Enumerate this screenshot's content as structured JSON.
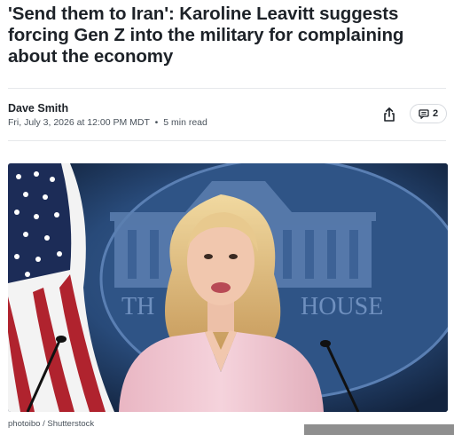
{
  "article": {
    "headline": "'Send them to Iran': Karoline Leavitt suggests forcing Gen Z into the military for complaining about the economy",
    "author": "Dave Smith",
    "date": "Fri, July 3, 2026 at 12:00 PM MDT",
    "separator": "•",
    "read_time": "5 min read"
  },
  "actions": {
    "share_icon": "share-icon",
    "comment_icon": "comment-icon",
    "comment_count": "2"
  },
  "photo": {
    "backdrop_text": "HOUSE",
    "backdrop_text_partial": "TH",
    "credit": "photoibo / Shutterstock"
  },
  "colors": {
    "backdrop_blue": "#2a4a78",
    "jacket_pink": "#f2c9d3",
    "flag_red": "#b0232e",
    "flag_blue": "#1c2c57"
  }
}
